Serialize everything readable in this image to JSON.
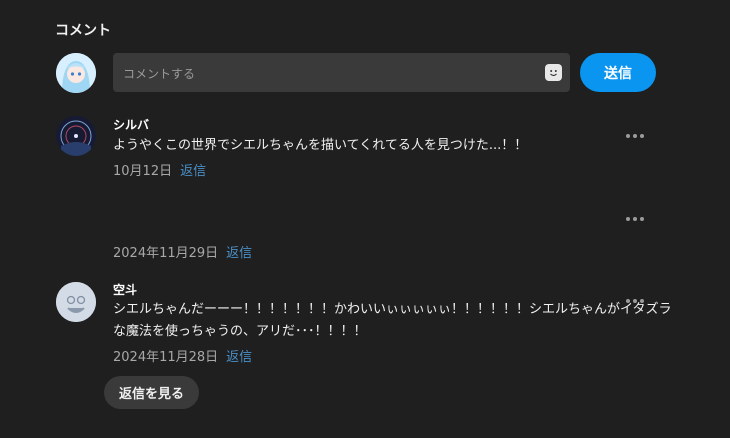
{
  "section": {
    "title": "コメント"
  },
  "composer": {
    "placeholder": "コメントする",
    "send_label": "送信"
  },
  "comments": [
    {
      "author": "シルバ",
      "text": "ようやくこの世界でシエルちゃんを描いてくれてる人を見つけた...！！",
      "date": "10月12日",
      "reply_label": "返信"
    },
    {
      "author": "",
      "text": "",
      "date": "2024年11月29日",
      "reply_label": "返信"
    },
    {
      "author": "空斗",
      "text_line1": "シエルちゃんだーーー！！！！！！！かわいいぃぃぃぃぃ！！！！！！シエルちゃんがイタズラ",
      "text_line2": "な魔法を使っちゃうの、アリだ･･･！！！！",
      "date": "2024年11月28日",
      "reply_label": "返信"
    }
  ],
  "view_replies_label": "返信を見る"
}
